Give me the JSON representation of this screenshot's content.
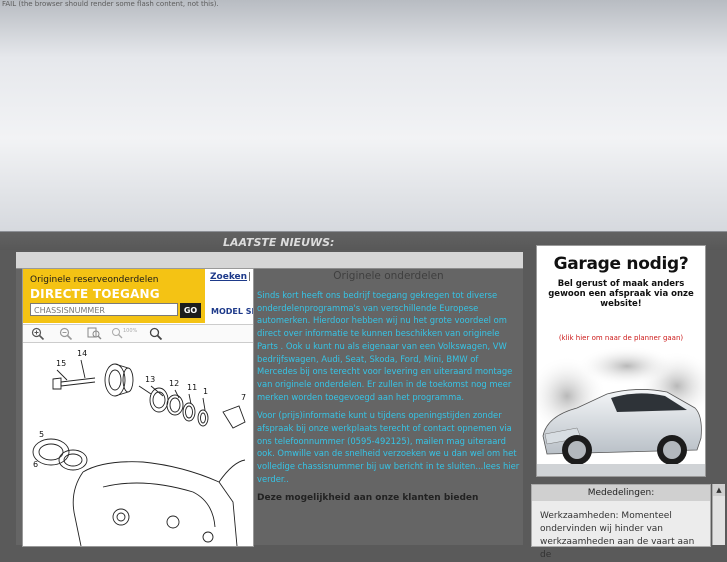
{
  "flash": {
    "fail_text": "FAIL (the browser should render some flash content, not this)."
  },
  "news_bar": {
    "title": "LAATSTE NIEUWS:"
  },
  "parts_viewer": {
    "subtitle": "Originele reserveonderdelen",
    "title": "DIRECTE TOEGANG",
    "chassis_placeholder": "CHASSISNUMMER",
    "go_label": "GO",
    "search_link": "Zoeken",
    "separator": "|",
    "model_select": "MODEL SELECTIE",
    "toolbar_icons": [
      "zoom-in-icon",
      "zoom-out-icon",
      "zoom-fit-icon",
      "zoom-100-icon",
      "search-icon"
    ],
    "zoom_100_label": "100%",
    "diagram_numbers": [
      "15",
      "14",
      "13",
      "12",
      "11",
      "1",
      "5",
      "6",
      "7"
    ]
  },
  "intro": {
    "heading": "Originele onderdelen",
    "para1": "Sinds kort heeft ons bedrijf toegang gekregen tot diverse onderdelenprogramma's van verschillende Europese automerken. Hierdoor hebben wij nu het grote voordeel om direct over informatie te kunnen beschikken van originele Parts . Ook u kunt nu als eigenaar van een Volkswagen, VW bedrijfswagen, Audi, Seat, Skoda, Ford, Mini, BMW of Mercedes bij ons terecht voor levering en uiteraard montage van originele onderdelen. Er zullen in de toekomst nog meer merken worden toegevoegd aan het programma.",
    "para2": "Voor (prijs)informatie kunt u tijdens openingstijden zonder afspraak bij onze werkplaats terecht of contact opnemen via ons telefoonnummer (0595-492125), mailen mag uiteraard ook. Omwille van de snelheid verzoeken we u dan wel om het volledige chassisnummer bij uw bericht in te sluiten...lees hier verder..",
    "para3": "Deze mogelijkheid aan onze klanten bieden"
  },
  "ad": {
    "title": "Garage nodig?",
    "subtitle": "Bel gerust of maak anders gewoon een afspraak via onze website!",
    "link": "(klik hier om naar de planner gaan)"
  },
  "news_panel": {
    "header": "Mededelingen:",
    "body": "Werkzaamheden: Momenteel ondervinden wij hinder van werkzaamheden aan de vaart aan de"
  },
  "scrollbar": {
    "up_arrow": "▲"
  },
  "colors": {
    "page_bg": "#5a5a5a",
    "intro_text": "#36c4e6",
    "parts_header": "#f4c314",
    "ad_link": "#cc1a1a"
  }
}
